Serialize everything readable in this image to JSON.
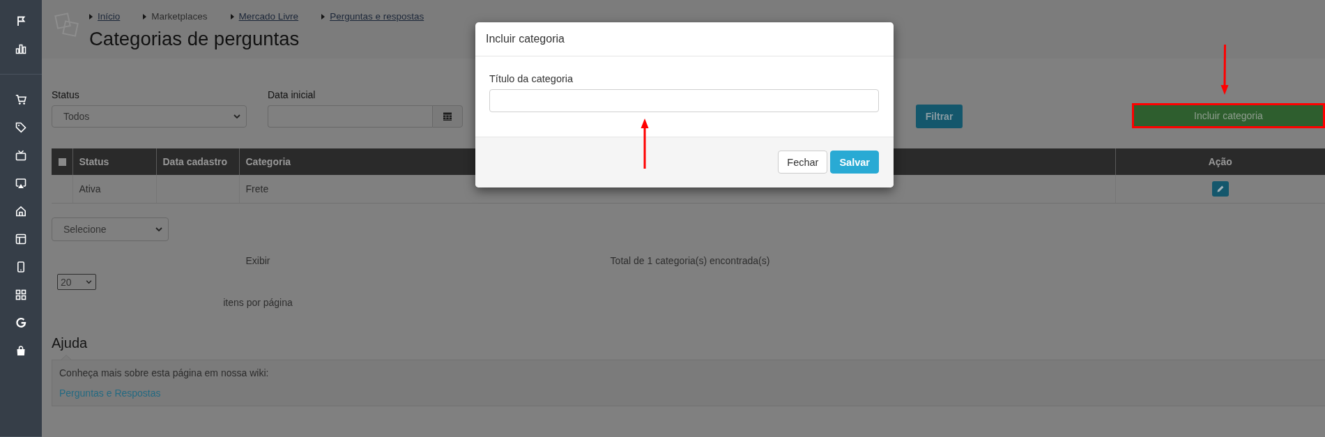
{
  "breadcrumb": [
    {
      "label": "Início",
      "link": true
    },
    {
      "label": "Marketplaces",
      "link": false
    },
    {
      "label": "Mercado Livre",
      "link": true
    },
    {
      "label": "Perguntas e respostas",
      "link": true
    }
  ],
  "page_title": "Categorias de perguntas",
  "filters": {
    "status": {
      "label": "Status",
      "value": "Todos"
    },
    "start_date": {
      "label": "Data inicial"
    },
    "filter_button": "Filtrar"
  },
  "include_button": {
    "label": "Incluir categoria",
    "highlighted": true,
    "annotation_arrow": true
  },
  "table": {
    "select_all": {
      "checked": false
    },
    "columns": [
      "Status",
      "Data cadastro",
      "Categoria",
      "Ação"
    ],
    "rows": [
      {
        "status": "Ativa",
        "category": "Frete"
      }
    ]
  },
  "bulk_action": {
    "value": "Selecione"
  },
  "pagination": {
    "show_label": "Exibir",
    "page_size": "20",
    "per_page_label": "itens por página",
    "total": "Total de 1 categoria(s) encontrada(s)"
  },
  "help": {
    "title": "Ajuda",
    "text": "Conheça mais sobre esta página em nossa wiki:",
    "link": "Perguntas e Respostas"
  },
  "modal": {
    "title": "Incluir categoria",
    "field": {
      "label": "Título da categoria",
      "annotation_arrow": true
    },
    "buttons": [
      {
        "label": "Fechar",
        "kind": "default"
      },
      {
        "label": "Salvar",
        "kind": "primary"
      }
    ]
  }
}
